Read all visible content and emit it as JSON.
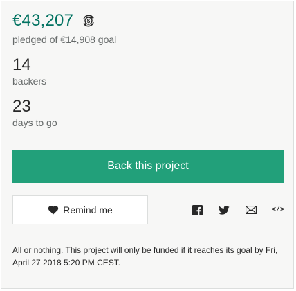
{
  "funding": {
    "amount": "€43,207",
    "pledged_text": "pledged of €14,908 goal",
    "currency_icon": "currency-conversion-icon"
  },
  "stats": {
    "backers_count": "14",
    "backers_label": "backers",
    "days_count": "23",
    "days_label": "days to go"
  },
  "actions": {
    "back_label": "Back this project",
    "remind_label": "Remind me",
    "share_icons": [
      "facebook-icon",
      "twitter-icon",
      "email-icon",
      "embed-icon"
    ],
    "embed_glyph": "</>"
  },
  "note": {
    "link_text": "All or nothing.",
    "text": " This project will only be funded if it reaches its goal by Fri, April 27 2018 5:20 PM CEST."
  },
  "colors": {
    "accent": "#037362",
    "button": "#22a07a",
    "card_bg": "#f7f7f6"
  }
}
